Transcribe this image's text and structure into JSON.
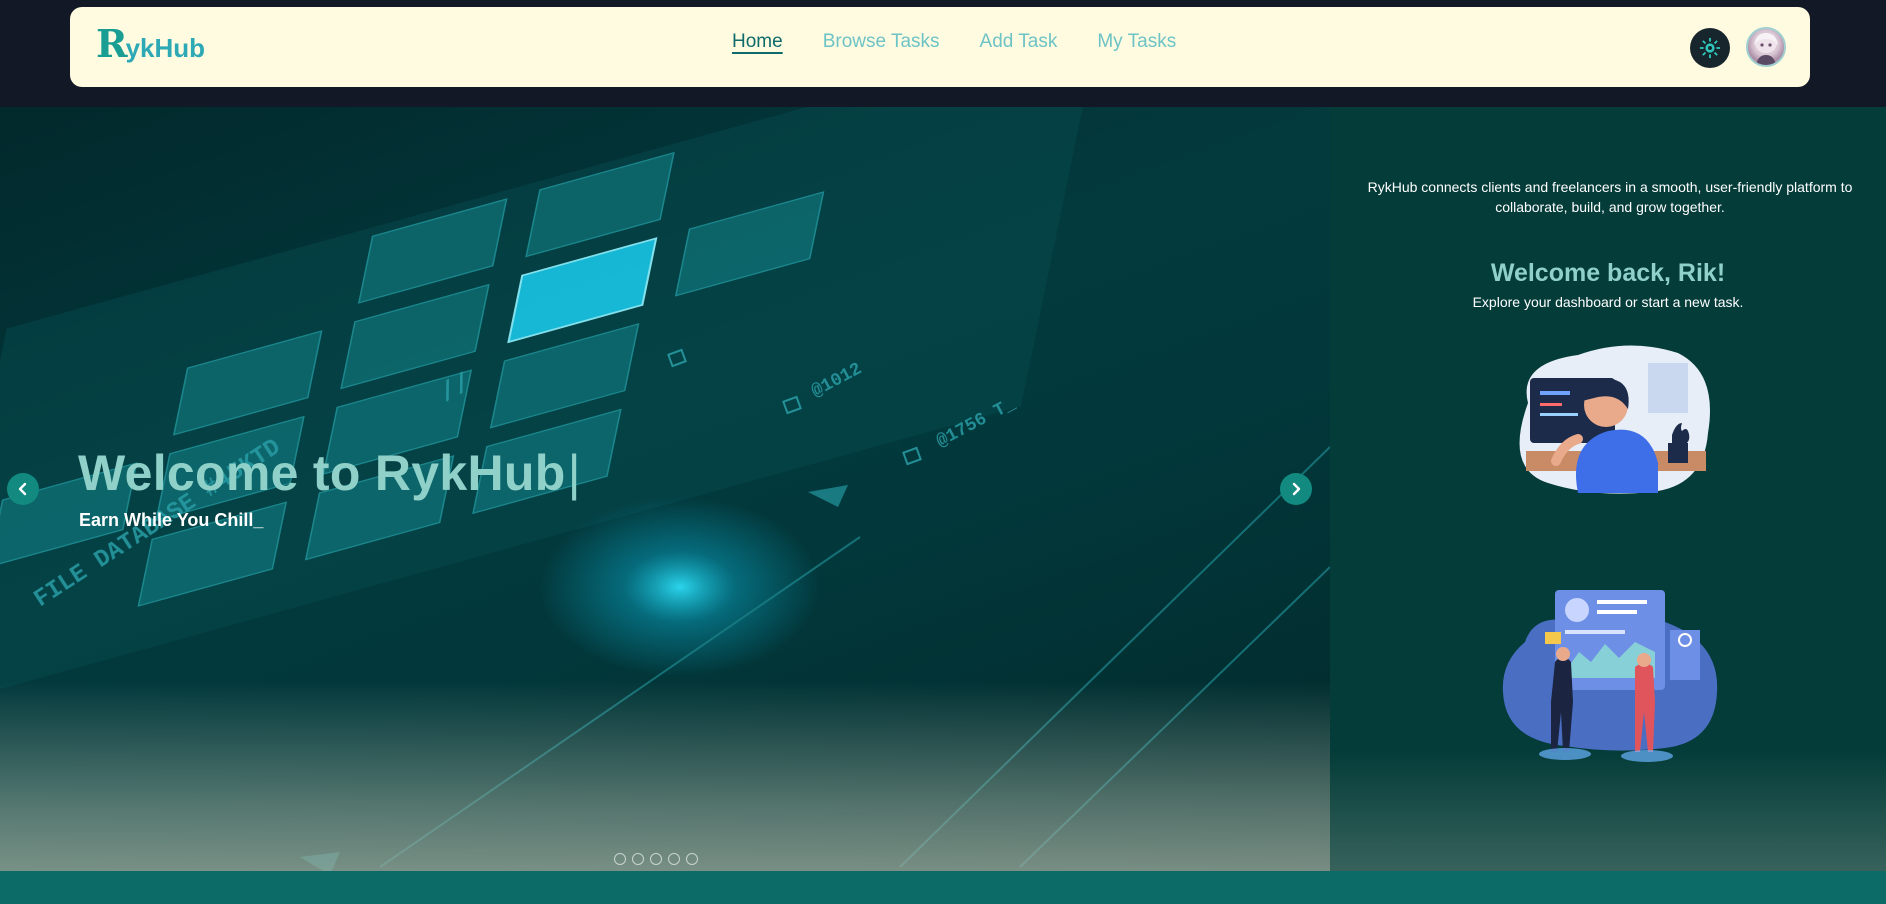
{
  "navbar": {
    "logo_initial": "R",
    "logo_rest": "ykHub",
    "links": [
      {
        "label": "Home",
        "active": true
      },
      {
        "label": "Browse Tasks",
        "active": false
      },
      {
        "label": "Add Task",
        "active": false
      },
      {
        "label": "My Tasks",
        "active": false
      }
    ],
    "theme_icon": "gear-icon",
    "avatar_icon": "user-avatar"
  },
  "slider": {
    "title": "Welcome to RykHub",
    "cursor": "|",
    "subtitle": "Earn While You Chill",
    "subtitle_cursor": "_",
    "prev_icon": "chevron-left-icon",
    "next_icon": "chevron-right-icon",
    "slide_count": 5,
    "background_labels": [
      "FILE DATABASE #45KTD",
      "@1012",
      "@1756 T_",
      "//"
    ]
  },
  "side": {
    "intro": "RykHub connects clients and freelancers in a smooth, user-friendly platform to collaborate, build, and grow together.",
    "welcome": "Welcome back, Rik!",
    "welcome_sub": "Explore your dashboard or start a new task."
  },
  "colors": {
    "navbar_bg": "#fffbe0",
    "accent": "#128a80",
    "hero_bg": "#033332",
    "title": "#8fd1c9",
    "page_bg": "#121826",
    "footer": "#0c6a67"
  }
}
